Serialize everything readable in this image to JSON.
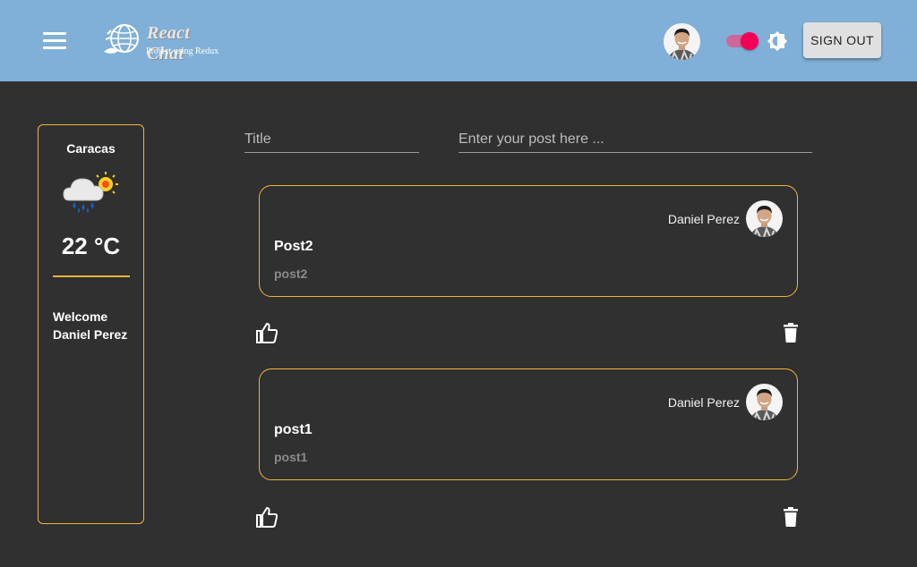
{
  "header": {
    "logo_title": "React Chat",
    "logo_subtitle": "Project using Redux",
    "signout_label": "SIGN OUT",
    "theme_toggle_on": true,
    "colors": {
      "appbar": "#80b0d8",
      "toggle": "#f50057",
      "accent": "#f0b43c"
    }
  },
  "sidebar": {
    "city": "Caracas",
    "weather_icon": "rain-cloud-sun-icon",
    "temperature": "22 °C",
    "welcome_line1": "Welcome",
    "welcome_line2": "Daniel Perez"
  },
  "composer": {
    "title_placeholder": "Title",
    "body_placeholder": "Enter your post here ..."
  },
  "posts": [
    {
      "author": "Daniel Perez",
      "title": "Post2",
      "body": "post2"
    },
    {
      "author": "Daniel Perez",
      "title": "post1",
      "body": "post1"
    }
  ]
}
